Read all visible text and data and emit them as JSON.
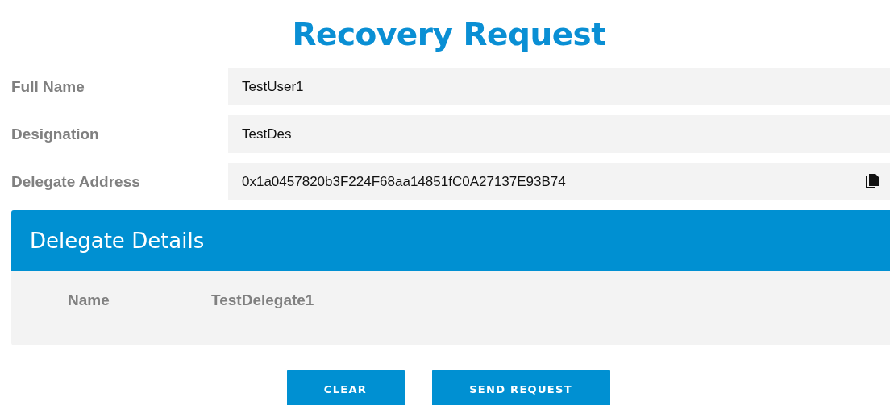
{
  "title": "Recovery Request",
  "fields": [
    {
      "label": "Full Name",
      "value": "TestUser1",
      "kind": "text"
    },
    {
      "label": "Designation",
      "value": "TestDes",
      "kind": "text"
    },
    {
      "label": "Delegate Address",
      "value": "0x1a0457820b3F224F68aa14851fC0A27137E93B74",
      "kind": "copyable"
    }
  ],
  "details": {
    "title": "Delegate Details",
    "rows": [
      {
        "label": "Name",
        "value": "TestDelegate1"
      }
    ]
  },
  "buttons": [
    "CLEAR",
    "SEND REQUEST"
  ]
}
